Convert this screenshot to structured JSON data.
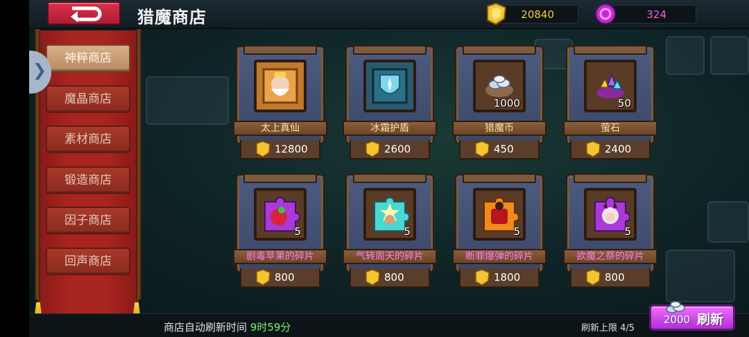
{
  "header": {
    "title": "猎魔商店",
    "gold_amount": "20840",
    "gem_amount": "324"
  },
  "sidebar": {
    "tabs": [
      {
        "label": "神粹商店",
        "active": true
      },
      {
        "label": "魔晶商店",
        "active": false
      },
      {
        "label": "素材商店",
        "active": false
      },
      {
        "label": "锻造商店",
        "active": false
      },
      {
        "label": "因子商店",
        "active": false
      },
      {
        "label": "回声商店",
        "active": false
      }
    ]
  },
  "items": [
    {
      "name": "太上真仙",
      "price": "12800",
      "quantity": "",
      "icon": "sage-portrait-icon",
      "name_color": "gold"
    },
    {
      "name": "冰霜护盾",
      "price": "2600",
      "quantity": "",
      "icon": "frost-shield-icon",
      "name_color": "gold"
    },
    {
      "name": "猎魔币",
      "price": "450",
      "quantity": "1000",
      "icon": "silver-coin-pile-icon",
      "name_color": "gold"
    },
    {
      "name": "萤石",
      "price": "2400",
      "quantity": "50",
      "icon": "crystal-pile-icon",
      "name_color": "gold"
    },
    {
      "name": "剧毒苹果的碎片",
      "price": "800",
      "quantity": "5",
      "icon": "poison-apple-fragment-icon",
      "name_color": "purple"
    },
    {
      "name": "气转周天的碎片",
      "price": "800",
      "quantity": "5",
      "icon": "meditation-fragment-icon",
      "name_color": "purple"
    },
    {
      "name": "断罪爆弹的碎片",
      "price": "1800",
      "quantity": "5",
      "icon": "bomb-fragment-icon",
      "name_color": "purple"
    },
    {
      "name": "欲魔之祭的碎片",
      "price": "800",
      "quantity": "5",
      "icon": "demon-girl-fragment-icon",
      "name_color": "purple"
    }
  ],
  "footer": {
    "refresh_time_label": "商店自动刷新时间",
    "refresh_time_value": "9时59分",
    "refresh_limit": "刷新上限 4/5",
    "refresh_cost": "2000",
    "refresh_label": "刷新"
  },
  "colors": {
    "gold_text": "#f4cc3a",
    "gem_text": "#ff5be0",
    "fragment_name": "#ff7cf2",
    "refresh_button": "#d24ef0",
    "timer_green": "#7ef068"
  }
}
